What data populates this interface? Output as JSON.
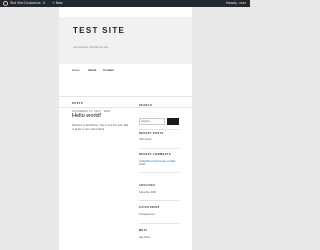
{
  "admin_bar": {
    "site_label": "Test Site",
    "customize_label": "Customize",
    "comments_count": "0",
    "new_label": "+ New",
    "howdy_label": "Howdy, user"
  },
  "site": {
    "title": "TEST SITE",
    "description": "Just another WordPress site"
  },
  "nav": {
    "items": [
      "Home",
      "About",
      "Contact"
    ]
  },
  "posts_heading": "POSTS",
  "post": {
    "meta": "NOVEMBER 21, 2020  ·  WEB",
    "title": "Hello world!",
    "body": "Welcome to WordPress. This is your first post. Edit or delete it, then start writing!"
  },
  "sidebar": {
    "search_title": "SEARCH",
    "search_placeholder": "Search ...",
    "recent_posts_title": "RECENT POSTS",
    "recent_posts": [
      "Hello world!"
    ],
    "recent_comments_title": "RECENT COMMENTS",
    "recent_comments": [
      "A WordPress Commenter on Hello world!"
    ],
    "archives_title": "ARCHIVES",
    "archives": [
      "November 2020"
    ],
    "categories_title": "CATEGORIES",
    "categories": [
      "Uncategorized"
    ],
    "meta_title": "META",
    "meta": [
      "Site Admin"
    ]
  }
}
